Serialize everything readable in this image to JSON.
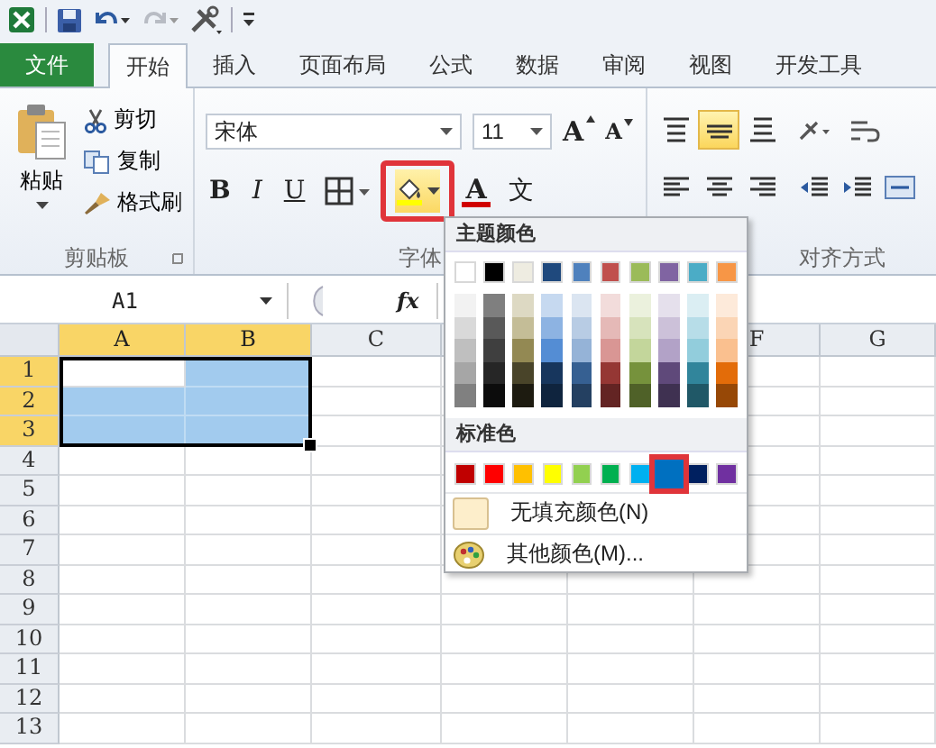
{
  "quick_access": {
    "redo_disabled": true
  },
  "tabs": [
    {
      "label": "文件",
      "kind": "file",
      "selected": false
    },
    {
      "label": "开始",
      "kind": "tab",
      "selected": true
    },
    {
      "label": "插入",
      "kind": "tab",
      "selected": false
    },
    {
      "label": "页面布局",
      "kind": "tab",
      "selected": false
    },
    {
      "label": "公式",
      "kind": "tab",
      "selected": false
    },
    {
      "label": "数据",
      "kind": "tab",
      "selected": false
    },
    {
      "label": "审阅",
      "kind": "tab",
      "selected": false
    },
    {
      "label": "视图",
      "kind": "tab",
      "selected": false
    },
    {
      "label": "开发工具",
      "kind": "tab",
      "selected": false
    }
  ],
  "clipboard": {
    "paste_label": "粘贴",
    "items": [
      {
        "label": "剪切",
        "kind": "cut"
      },
      {
        "label": "复制",
        "kind": "copy"
      },
      {
        "label": "格式刷",
        "kind": "brush"
      }
    ],
    "group_label": "剪贴板"
  },
  "font": {
    "font_name": "宋体",
    "font_size": "11",
    "grow": "A",
    "shrink": "A",
    "buttons": [
      {
        "label": "B",
        "kind": "bold"
      },
      {
        "label": "I",
        "kind": "italic"
      },
      {
        "label": "U",
        "kind": "underline"
      },
      {
        "kind": "border"
      },
      {
        "kind": "fill",
        "highlighted": true
      },
      {
        "label": "A",
        "kind": "font-color"
      },
      {
        "label": "文",
        "kind": "phonetic"
      }
    ],
    "group_label": "字体"
  },
  "alignment": {
    "rows": [
      [
        {
          "kind": "top",
          "selected": false
        },
        {
          "kind": "middle",
          "selected": true
        },
        {
          "kind": "bottom",
          "selected": false
        },
        {
          "kind": "orient",
          "selected": false
        },
        {
          "kind": "wrap",
          "selected": false
        }
      ],
      [
        {
          "kind": "left",
          "selected": false
        },
        {
          "kind": "center",
          "selected": false
        },
        {
          "kind": "right",
          "selected": false
        },
        {
          "kind": "outdent",
          "selected": false
        },
        {
          "kind": "indent",
          "selected": false
        },
        {
          "kind": "merge",
          "selected": false
        }
      ]
    ],
    "group_label": "对齐方式"
  },
  "formula_bar": {
    "name_box": "A1",
    "function_label": "fx"
  },
  "sheet": {
    "columns": [
      {
        "label": "A",
        "selected": true
      },
      {
        "label": "B",
        "selected": true
      },
      {
        "label": "C",
        "selected": false
      },
      {},
      {},
      {
        "label": "F",
        "selected": false
      },
      {
        "label": "G",
        "selected": false
      }
    ],
    "rows": [
      {
        "label": "1",
        "selected": true,
        "filled": [
          false,
          true
        ]
      },
      {
        "label": "2",
        "selected": true,
        "filled": [
          true,
          true
        ]
      },
      {
        "label": "3",
        "selected": true,
        "filled": [
          true,
          true
        ]
      },
      {
        "label": "4",
        "selected": false,
        "filled": [
          false,
          false
        ]
      },
      {
        "label": "5",
        "selected": false,
        "filled": [
          false,
          false
        ]
      },
      {
        "label": "6",
        "selected": false,
        "filled": [
          false,
          false
        ]
      },
      {
        "label": "7",
        "selected": false,
        "filled": [
          false,
          false
        ]
      },
      {
        "label": "8",
        "selected": false,
        "filled": [
          false,
          false
        ]
      },
      {
        "label": "9",
        "selected": false,
        "filled": [
          false,
          false
        ]
      },
      {
        "label": "10",
        "selected": false,
        "filled": [
          false,
          false
        ]
      },
      {
        "label": "11",
        "selected": false,
        "filled": [
          false,
          false
        ]
      },
      {
        "label": "12",
        "selected": false,
        "filled": [
          false,
          false
        ]
      },
      {
        "label": "13",
        "selected": false,
        "filled": [
          false,
          false
        ]
      }
    ]
  },
  "color_menu": {
    "theme_label": "主题颜色",
    "theme": [
      {
        "color": "#ffffff",
        "shades": [
          {
            "color": "#f2f2f2"
          },
          {
            "color": "#d9d9d9"
          },
          {
            "color": "#bfbfbf"
          },
          {
            "color": "#a6a6a6"
          },
          {
            "color": "#808080"
          }
        ]
      },
      {
        "color": "#000000",
        "shades": [
          {
            "color": "#7f7f7f"
          },
          {
            "color": "#595959"
          },
          {
            "color": "#3f3f3f"
          },
          {
            "color": "#262626"
          },
          {
            "color": "#0c0c0c"
          }
        ]
      },
      {
        "color": "#eeece1",
        "shades": [
          {
            "color": "#ddd9c3"
          },
          {
            "color": "#c4bd97"
          },
          {
            "color": "#938953"
          },
          {
            "color": "#494429"
          },
          {
            "color": "#1d1b10"
          }
        ]
      },
      {
        "color": "#1f497d",
        "shades": [
          {
            "color": "#c6d9f0"
          },
          {
            "color": "#8db3e2"
          },
          {
            "color": "#548dd4"
          },
          {
            "color": "#17365d"
          },
          {
            "color": "#0f243e"
          }
        ]
      },
      {
        "color": "#4f81bd",
        "shades": [
          {
            "color": "#dbe5f1"
          },
          {
            "color": "#b8cce4"
          },
          {
            "color": "#95b3d7"
          },
          {
            "color": "#366092"
          },
          {
            "color": "#244061"
          }
        ]
      },
      {
        "color": "#c0504d",
        "shades": [
          {
            "color": "#f2dcdb"
          },
          {
            "color": "#e5b9b7"
          },
          {
            "color": "#d99694"
          },
          {
            "color": "#953734"
          },
          {
            "color": "#632423"
          }
        ]
      },
      {
        "color": "#9bbb59",
        "shades": [
          {
            "color": "#ebf1dd"
          },
          {
            "color": "#d7e3bc"
          },
          {
            "color": "#c3d69b"
          },
          {
            "color": "#76923c"
          },
          {
            "color": "#4f6128"
          }
        ]
      },
      {
        "color": "#8064a2",
        "shades": [
          {
            "color": "#e5e0ec"
          },
          {
            "color": "#ccc1d9"
          },
          {
            "color": "#b2a2c7"
          },
          {
            "color": "#5f497a"
          },
          {
            "color": "#3f3151"
          }
        ]
      },
      {
        "color": "#4bacc6",
        "shades": [
          {
            "color": "#dbeef3"
          },
          {
            "color": "#b7dde8"
          },
          {
            "color": "#92cddc"
          },
          {
            "color": "#31859b"
          },
          {
            "color": "#205867"
          }
        ]
      },
      {
        "color": "#f79646",
        "shades": [
          {
            "color": "#fdeada"
          },
          {
            "color": "#fbd5b5"
          },
          {
            "color": "#fac08f"
          },
          {
            "color": "#e36c09"
          },
          {
            "color": "#974806"
          }
        ]
      }
    ],
    "standard_label": "标准色",
    "standard": [
      {
        "color": "#c00000",
        "selected": false
      },
      {
        "color": "#ff0000",
        "selected": false
      },
      {
        "color": "#ffc000",
        "selected": false
      },
      {
        "color": "#ffff00",
        "selected": false
      },
      {
        "color": "#92d050",
        "selected": false
      },
      {
        "color": "#00b050",
        "selected": false
      },
      {
        "color": "#00b0f0",
        "selected": false
      },
      {
        "color": "#0070c0",
        "selected": true
      },
      {
        "color": "#002060",
        "selected": false
      },
      {
        "color": "#7030a0",
        "selected": false
      }
    ],
    "no_fill": "无填充颜色(N)",
    "more_colors": "其他颜色(M)..."
  }
}
